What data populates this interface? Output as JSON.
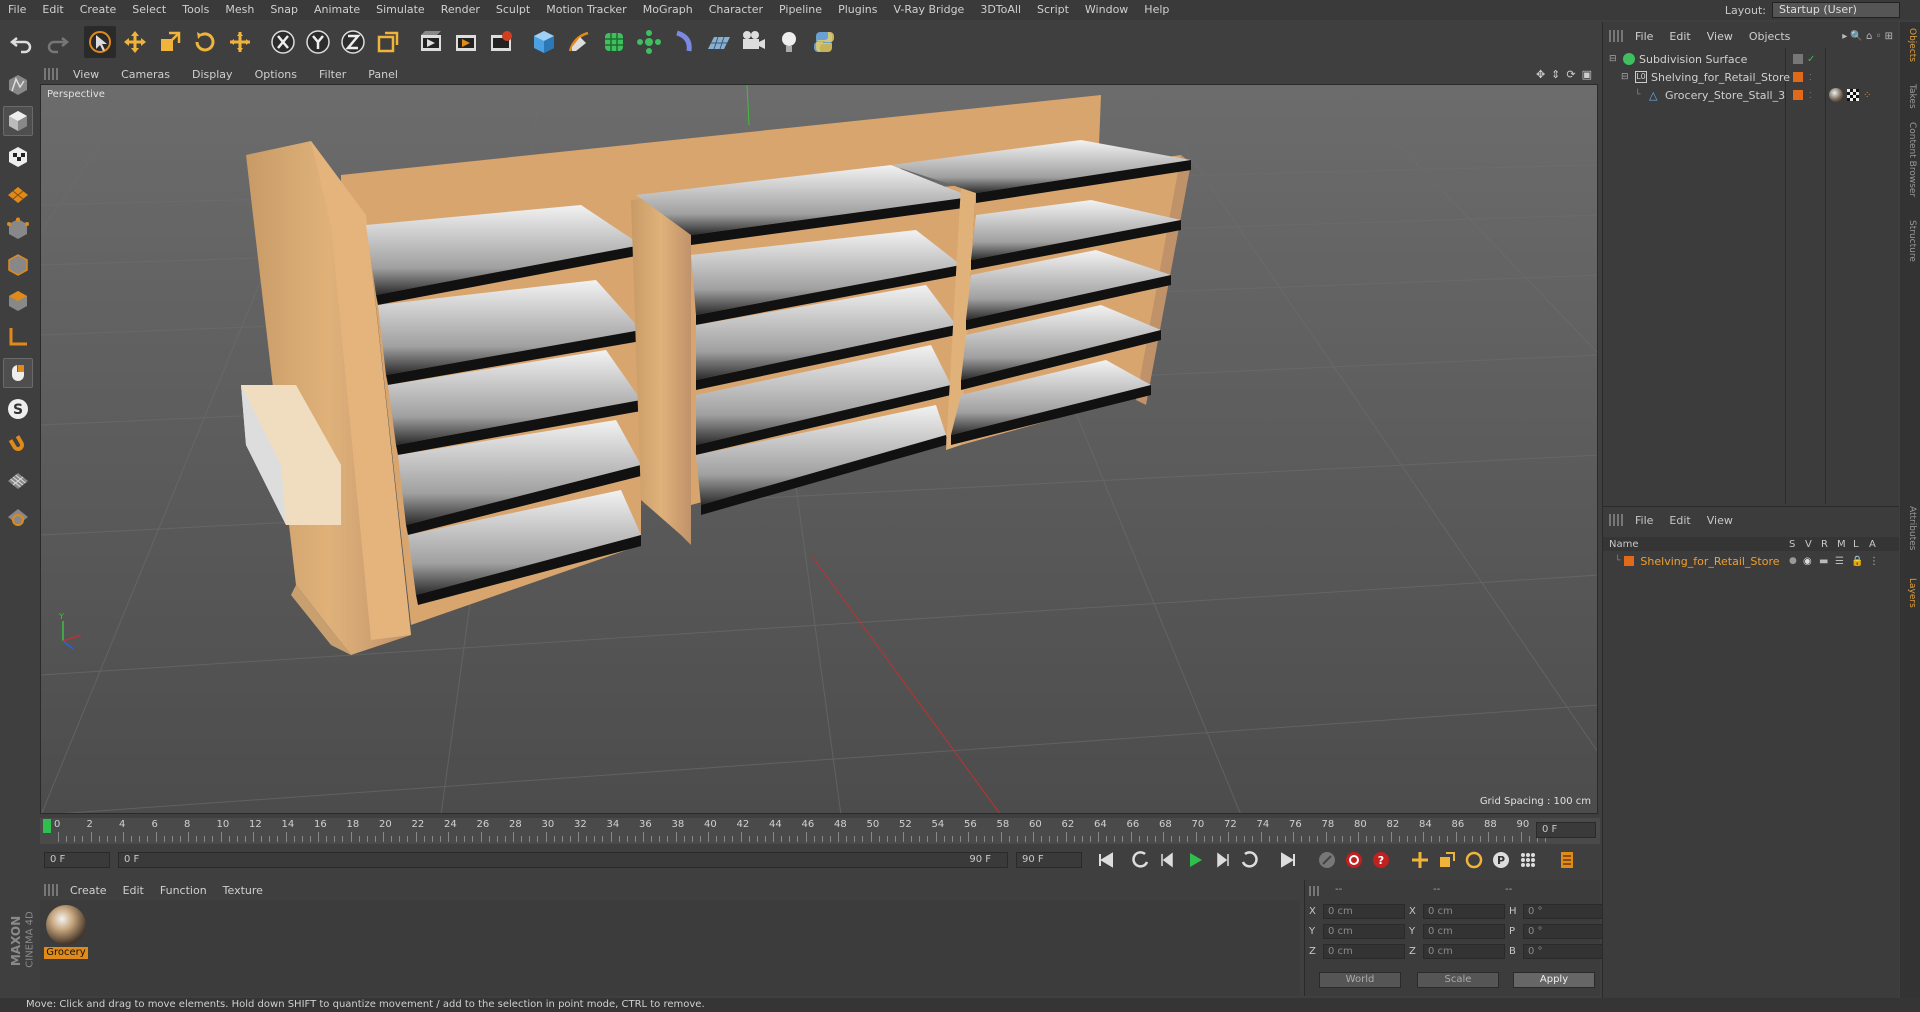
{
  "menu": [
    "File",
    "Edit",
    "Create",
    "Select",
    "Tools",
    "Mesh",
    "Snap",
    "Animate",
    "Simulate",
    "Render",
    "Sculpt",
    "Motion Tracker",
    "MoGraph",
    "Character",
    "Pipeline",
    "Plugins",
    "V-Ray Bridge",
    "3DToAll",
    "Script",
    "Window",
    "Help"
  ],
  "layout": {
    "label": "Layout:",
    "value": "Startup (User)"
  },
  "toolbar": {
    "icons": [
      "undo-icon",
      "redo-icon",
      "select-arrow-icon",
      "move-icon",
      "scale-icon",
      "rotate-icon",
      "live-select-icon",
      "x-axis-icon",
      "y-axis-icon",
      "z-axis-icon",
      "coordinate-system-icon",
      "render-view-icon",
      "render-picture-viewer-icon",
      "render-settings-icon",
      "cube-icon",
      "pen-icon",
      "subdivision-icon",
      "array-icon",
      "deformer-icon",
      "floor-icon",
      "camera-icon",
      "light-icon",
      "python-icon"
    ]
  },
  "left_tools": [
    "make-editable-icon",
    "model-mode-icon",
    "texture-mode-icon",
    "workplane-icon",
    "points-mode-icon",
    "edges-mode-icon",
    "polygons-mode-icon",
    "axis-icon",
    "tweak-icon",
    "solo-icon",
    "snap-icon",
    "grid-snap-icon",
    "lock-icon"
  ],
  "viewport": {
    "menu": [
      "View",
      "Cameras",
      "Display",
      "Options",
      "Filter",
      "Panel"
    ],
    "label": "Perspective",
    "grid_spacing": "Grid Spacing : 100 cm"
  },
  "timeline": {
    "ticks": [
      "0",
      "2",
      "4",
      "6",
      "8",
      "10",
      "12",
      "14",
      "16",
      "18",
      "20",
      "22",
      "24",
      "26",
      "28",
      "30",
      "32",
      "34",
      "36",
      "38",
      "40",
      "42",
      "44",
      "46",
      "48",
      "50",
      "52",
      "54",
      "56",
      "58",
      "60",
      "62",
      "64",
      "66",
      "68",
      "70",
      "72",
      "74",
      "76",
      "78",
      "80",
      "82",
      "84",
      "86",
      "88",
      "90"
    ],
    "current": "0 F",
    "start": "0 F",
    "range_start": "0 F",
    "range_end": "90 F",
    "end": "90 F"
  },
  "materials": {
    "menu": [
      "Create",
      "Edit",
      "Function",
      "Texture"
    ],
    "items": [
      {
        "name": "Grocery"
      }
    ]
  },
  "coords": {
    "headers": [
      "--",
      "--",
      "--"
    ],
    "rows": [
      {
        "a": "X",
        "av": "0 cm",
        "b": "X",
        "bv": "0 cm",
        "c": "H",
        "cv": "0 °"
      },
      {
        "a": "Y",
        "av": "0 cm",
        "b": "Y",
        "bv": "0 cm",
        "c": "P",
        "cv": "0 °"
      },
      {
        "a": "Z",
        "av": "0 cm",
        "b": "Z",
        "bv": "0 cm",
        "c": "B",
        "cv": "0 °"
      }
    ],
    "world": "World",
    "scale": "Scale",
    "apply": "Apply"
  },
  "objects": {
    "menu": [
      "File",
      "Edit",
      "View",
      "Objects"
    ],
    "items": [
      {
        "name": "Subdivision Surface"
      },
      {
        "name": "Shelving_for_Retail_Store"
      },
      {
        "name": "Grocery_Store_Stall_3"
      }
    ]
  },
  "layers": {
    "menu": [
      "File",
      "Edit",
      "View"
    ],
    "columns": {
      "name": "Name",
      "s": "S",
      "v": "V",
      "r": "R",
      "m": "M",
      "l": "L",
      "a": "A"
    },
    "items": [
      {
        "name": "Shelving_for_Retail_Store"
      }
    ]
  },
  "right_tabs": [
    "Objects",
    "Takes",
    "Content Browser",
    "Structure",
    "Attributes",
    "Layers"
  ],
  "status": "Move: Click and drag to move elements. Hold down SHIFT to quantize movement / add to the selection in point mode, CTRL to remove.",
  "logo": {
    "brand": "MAXON",
    "product": "CINEMA 4D"
  },
  "colors": {
    "accent": "#e08a1a",
    "active_green": "#2fbf4f",
    "shelf_wood": "#d8a56e"
  }
}
